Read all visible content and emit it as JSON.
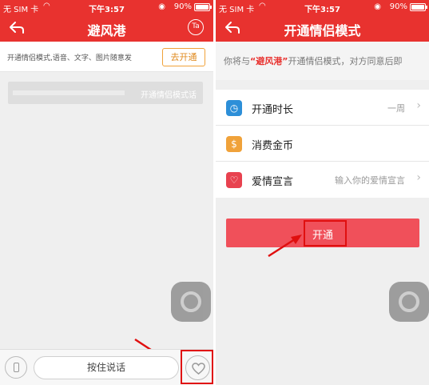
{
  "status": {
    "carrier": "无 SIM 卡",
    "time": "下午3:57",
    "battery": "90%",
    "battery_level": 0.9
  },
  "colors": {
    "brand": "#e8322f",
    "go_button": "#f0a23a",
    "open_button": "#f0505a",
    "highlight": "#e00f0f"
  },
  "chat": {
    "title": "避风港",
    "ta_label": "Ta",
    "banner_text": "开通情侣模式,语音、文字、图片随意发",
    "banner_button": "去开通",
    "message_text": "开通情侣模式话",
    "talk_button": "按住说话",
    "icons": [
      "back-arrow-icon",
      "ta-icon",
      "voice-toggle-icon",
      "heart-icon"
    ]
  },
  "couple_mode": {
    "title": "开通情侣模式",
    "intro_prefix": "你将与",
    "intro_name": "“避风港”",
    "intro_suffix": "开通情侣模式，对方同意后即",
    "rows": [
      {
        "label": "开通时长",
        "value": "一周",
        "icon": "clock-icon",
        "color": "#2d8fd8"
      },
      {
        "label": "消费金币",
        "value": "",
        "icon": "coin-icon",
        "color": "#f0a23a"
      },
      {
        "label": "爱情宣言",
        "value": "输入你的爱情宣言",
        "icon": "heart-badge-icon",
        "color": "#e8424f"
      }
    ],
    "open_button": "开通"
  }
}
